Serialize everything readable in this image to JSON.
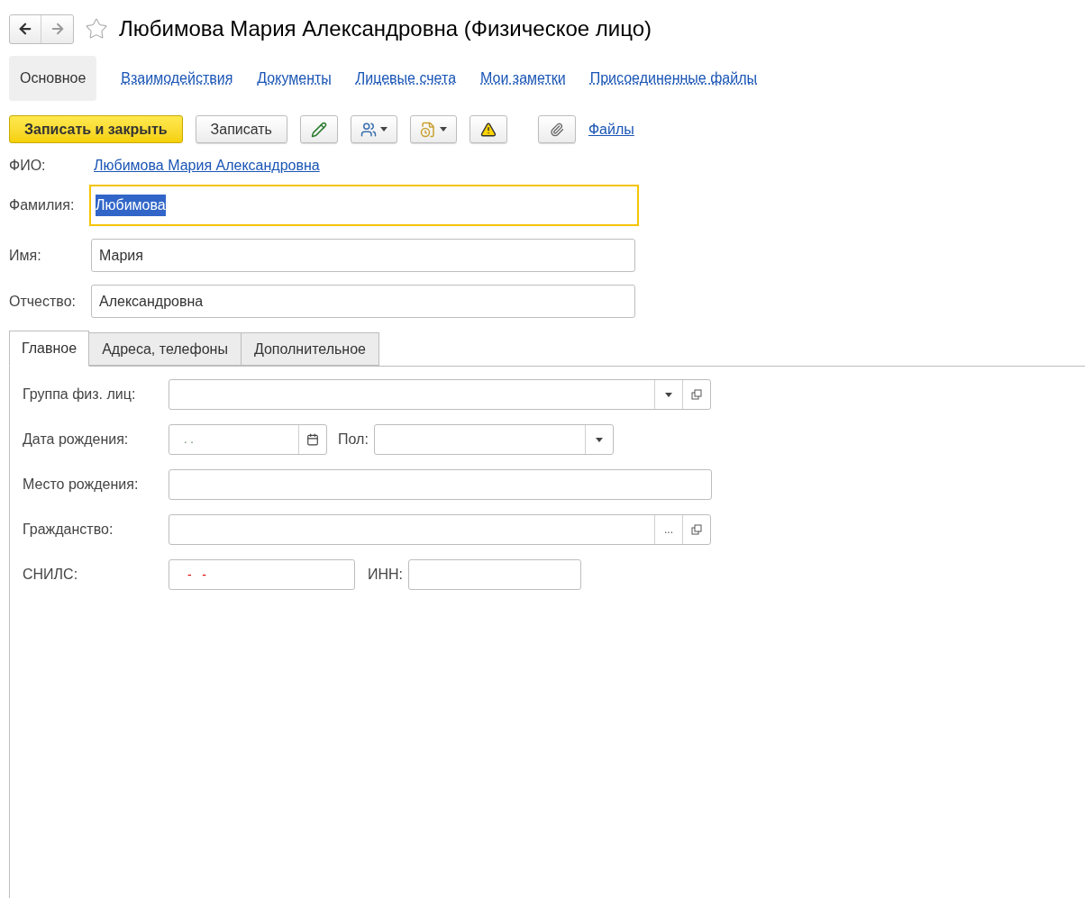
{
  "window": {
    "title": "Любимова Мария Александровна (Физическое лицо)",
    "favorite": false
  },
  "sections": [
    {
      "label": "Основное",
      "selected": true
    },
    {
      "label": "Взаимодействия",
      "selected": false
    },
    {
      "label": "Документы",
      "selected": false
    },
    {
      "label": "Лицевые счета",
      "selected": false
    },
    {
      "label": "Мои заметки",
      "selected": false
    },
    {
      "label": "Присоединенные файлы",
      "selected": false
    }
  ],
  "toolbar": [
    {
      "kind": "primary",
      "label": "Записать и закрыть"
    },
    {
      "kind": "button",
      "label": "Записать"
    },
    {
      "kind": "edit-history"
    },
    {
      "kind": "users-menu"
    },
    {
      "kind": "document-menu"
    },
    {
      "kind": "warning"
    },
    {
      "kind": "attach"
    },
    {
      "kind": "link",
      "label": "Файлы"
    }
  ],
  "fio": {
    "label": "ФИО:",
    "value": "Любимова Мария Александровна"
  },
  "name_fields": [
    {
      "label": "Фамилия:",
      "value": "Любимова",
      "focused": true
    },
    {
      "label": "Имя:",
      "value": "Мария",
      "focused": false
    },
    {
      "label": "Отчество:",
      "value": "Александровна",
      "focused": false
    }
  ],
  "tabs": [
    {
      "label": "Главное",
      "selected": true
    },
    {
      "label": "Адреса, телефоны",
      "selected": false
    },
    {
      "label": "Дополнительное",
      "selected": false
    }
  ],
  "fields": [
    {
      "label": "Группа физ. лиц:",
      "kind": "choice-open"
    },
    {
      "label": "Дата рождения:",
      "kind": "date",
      "mask": ". .",
      "extra": {
        "label": "Пол:",
        "kind": "choice"
      }
    },
    {
      "label": "Место рождения:",
      "kind": "text"
    },
    {
      "label": "Гражданство:",
      "kind": "select-open",
      "button": "..."
    },
    {
      "label": "СНИЛС:",
      "kind": "masked",
      "mask": "-   -",
      "extra": {
        "label": "ИНН:",
        "kind": "short"
      }
    }
  ]
}
